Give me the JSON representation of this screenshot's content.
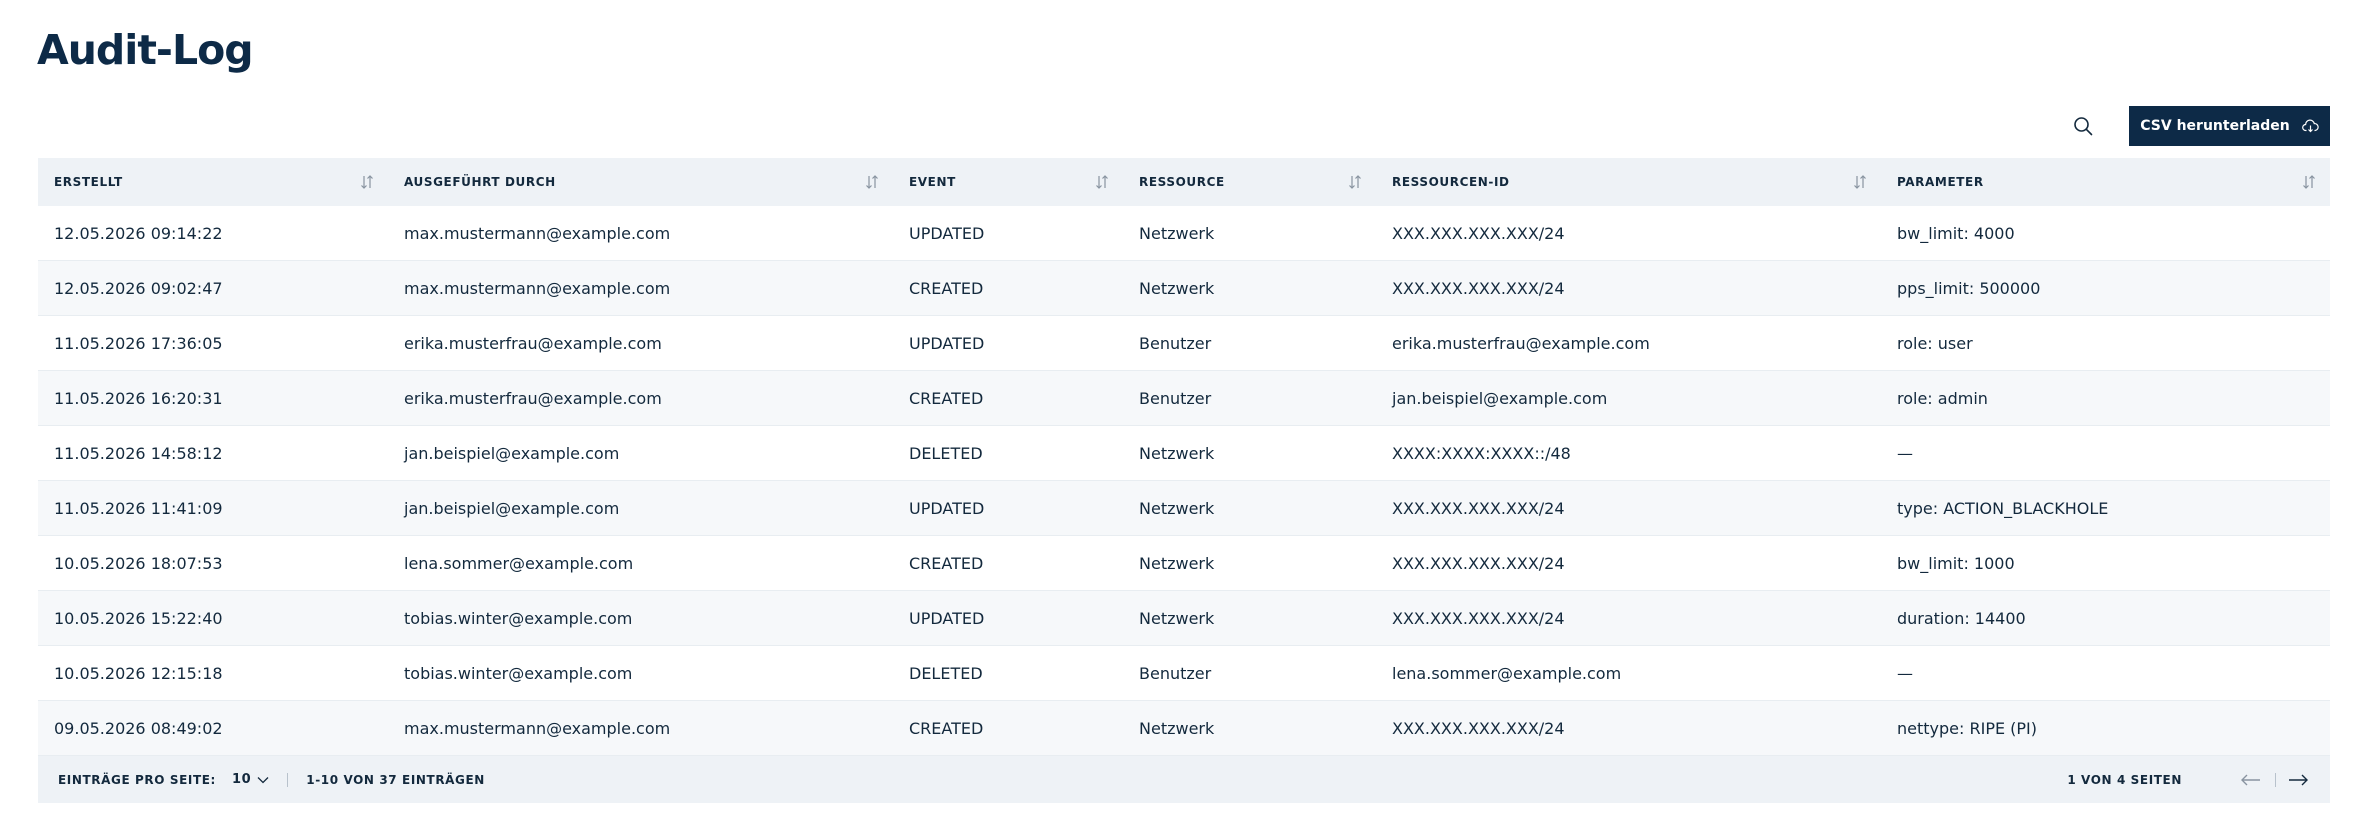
{
  "page": {
    "title": "Audit-Log"
  },
  "toolbar": {
    "csv_label": "CSV herunterladen"
  },
  "table": {
    "columns": [
      "Erstellt",
      "Ausgeführt durch",
      "Event",
      "Ressource",
      "Ressourcen-ID",
      "Parameter"
    ],
    "rows": [
      [
        "12.05.2026 09:14:22",
        "max.mustermann@example.com",
        "UPDATED",
        "Netzwerk",
        "XXX.XXX.XXX.XXX/24",
        "bw_limit: 4000"
      ],
      [
        "12.05.2026 09:02:47",
        "max.mustermann@example.com",
        "CREATED",
        "Netzwerk",
        "XXX.XXX.XXX.XXX/24",
        "pps_limit: 500000"
      ],
      [
        "11.05.2026 17:36:05",
        "erika.musterfrau@example.com",
        "UPDATED",
        "Benutzer",
        "erika.musterfrau@example.com",
        "role: user"
      ],
      [
        "11.05.2026 16:20:31",
        "erika.musterfrau@example.com",
        "CREATED",
        "Benutzer",
        "jan.beispiel@example.com",
        "role: admin"
      ],
      [
        "11.05.2026 14:58:12",
        "jan.beispiel@example.com",
        "DELETED",
        "Netzwerk",
        "XXXX:XXXX:XXXX::/48",
        "—"
      ],
      [
        "11.05.2026 11:41:09",
        "jan.beispiel@example.com",
        "UPDATED",
        "Netzwerk",
        "XXX.XXX.XXX.XXX/24",
        "type: ACTION_BLACKHOLE"
      ],
      [
        "10.05.2026 18:07:53",
        "lena.sommer@example.com",
        "CREATED",
        "Netzwerk",
        "XXX.XXX.XXX.XXX/24",
        "bw_limit: 1000"
      ],
      [
        "10.05.2026 15:22:40",
        "tobias.winter@example.com",
        "UPDATED",
        "Netzwerk",
        "XXX.XXX.XXX.XXX/24",
        "duration: 14400"
      ],
      [
        "10.05.2026 12:15:18",
        "tobias.winter@example.com",
        "DELETED",
        "Benutzer",
        "lena.sommer@example.com",
        "—"
      ],
      [
        "09.05.2026 08:49:02",
        "max.mustermann@example.com",
        "CREATED",
        "Netzwerk",
        "XXX.XXX.XXX.XXX/24",
        "nettype: RIPE (PI)"
      ]
    ]
  },
  "footer": {
    "per_page_label": "Einträge pro Seite:",
    "per_page_value": "10",
    "range_label": "1-10 von 37 Einträgen",
    "page_label": "1 von 4 Seiten"
  },
  "icons": {
    "search": "search-icon",
    "download": "cloud-download-icon",
    "sort": "sort-icon",
    "chevron": "chevron-down-icon",
    "prev": "arrow-left-icon",
    "next": "arrow-right-icon"
  },
  "colors": {
    "primary": "#0d2a47",
    "header_bg": "#eef2f6",
    "alt_row": "#f6f8fa"
  }
}
